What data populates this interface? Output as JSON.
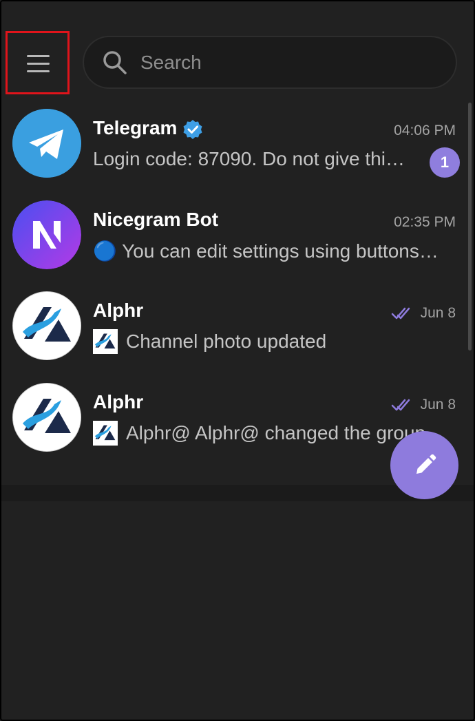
{
  "search": {
    "placeholder": "Search"
  },
  "chats": [
    {
      "name": "Telegram",
      "verified": true,
      "time": "04:06 PM",
      "preview": "Login code: 87090. Do not give thi…",
      "unread": "1",
      "avatar": "telegram-logo"
    },
    {
      "name": "Nicegram Bot",
      "verified": false,
      "time": "02:35 PM",
      "preview": "🔵 You can edit settings using buttons…",
      "avatar": "nicegram-logo"
    },
    {
      "name": "Alphr",
      "time": "Jun 8",
      "status": "read",
      "preview": "Channel photo updated",
      "avatar": "alphr-logo"
    },
    {
      "name": "Alphr",
      "time": "Jun 8",
      "status": "read",
      "preview": "Alphr@ Alphr@ changed the group…",
      "avatar": "alphr-logo"
    }
  ],
  "colors": {
    "background": "#212121",
    "accent": "#8e7bdd",
    "highlight_box": "#e0141b",
    "verified": "#3e9fe6"
  }
}
